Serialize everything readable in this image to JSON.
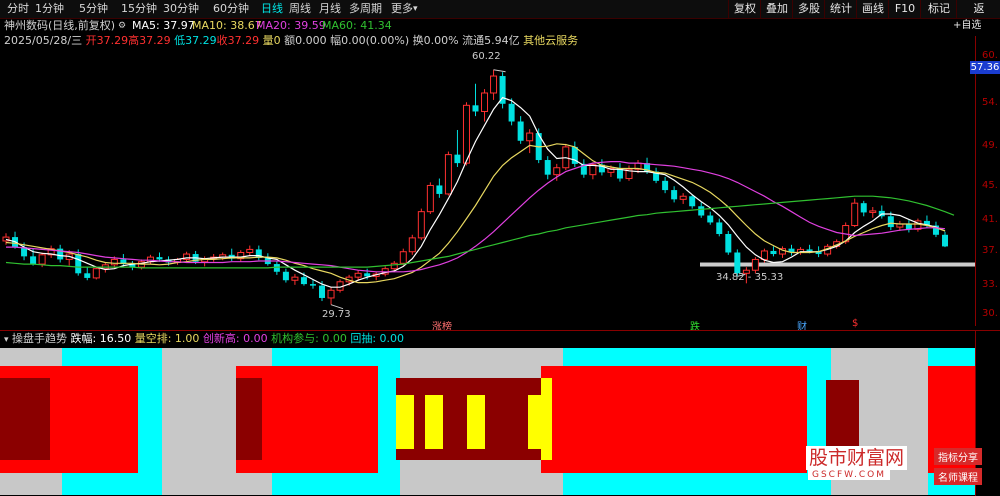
{
  "toolbar": {
    "periods": [
      "分时",
      "1分钟",
      "5分钟",
      "15分钟",
      "30分钟",
      "60分钟",
      "日线",
      "周线",
      "月线",
      "多周期",
      "更多"
    ],
    "active": "日线",
    "right": [
      "复权",
      "叠加",
      "多股",
      "统计",
      "画线",
      "F10",
      "标记",
      "返"
    ],
    "dropdown": "▾"
  },
  "header": {
    "name": "神州数码(日线,前复权)",
    "ma5": "MA5: 37.97",
    "ma10": "MA10: 38.67",
    "ma20": "MA20: 39.59",
    "ma60": "MA60: 41.34",
    "add": "+自选"
  },
  "quote": {
    "date": "2025/05/28/三",
    "open": "开37.29",
    "high": "高37.29",
    "low": "低37.29",
    "close": "收37.29",
    "vol": "量0",
    "amount": "额0.000",
    "amp": "幅0.00(0.00%)",
    "turn": "换0.00%",
    "float": "流通5.94亿",
    "cloud": "其他云服务"
  },
  "axis": {
    "ticks": [
      "60.",
      "57.36",
      "54.",
      "49.",
      "45.",
      "41.",
      "37.",
      "33.",
      "30."
    ],
    "current": "57.36"
  },
  "marks": {
    "high": "60.22",
    "low": "29.73",
    "range": "34.82 - 35.33"
  },
  "labels": {
    "l1": "涨榜",
    "l2": "跌",
    "l3": "财",
    "l4": "$"
  },
  "indicator": {
    "name": "操盘手趋势",
    "drop": "跌幅: 16.50",
    "vol": "量空排: 1.00",
    "newhigh": "创新高: 0.00",
    "inst": "机构参与: 0.00",
    "back": "回抽: 0.00"
  },
  "watermark": {
    "site": "股市财富网",
    "url": "GSCFW.COM",
    "tag1": "指标分享",
    "tag2": "名师课程"
  },
  "colors": {
    "up": "#ff3030",
    "down": "#00e0e0",
    "ma5": "#ffffff",
    "ma10": "#e8d860",
    "ma20": "#e040e0",
    "ma60": "#30c030"
  },
  "chart_data": {
    "type": "candlestick",
    "y_range": [
      28,
      62
    ],
    "candles": [
      [
        38,
        39,
        37.5,
        38.5
      ],
      [
        38.5,
        39.2,
        37,
        37.2
      ],
      [
        37.2,
        37.8,
        35.5,
        36
      ],
      [
        36,
        37,
        34.8,
        35
      ],
      [
        35,
        36.5,
        34.6,
        36.2
      ],
      [
        36.2,
        37.4,
        35.8,
        37
      ],
      [
        37,
        37.5,
        35.2,
        35.6
      ],
      [
        35.6,
        36.8,
        34.8,
        36.3
      ],
      [
        36.3,
        36.9,
        33.5,
        33.8
      ],
      [
        33.8,
        34.6,
        32.9,
        33.2
      ],
      [
        33.2,
        34.7,
        33,
        34.4
      ],
      [
        34.4,
        35.2,
        33.9,
        34.9
      ],
      [
        34.9,
        36,
        34.5,
        35.6
      ],
      [
        35.6,
        36.3,
        34.7,
        35
      ],
      [
        35,
        35.4,
        34.2,
        34.6
      ],
      [
        34.6,
        35.6,
        34.3,
        35.3
      ],
      [
        35.3,
        36.2,
        35,
        35.9
      ],
      [
        35.9,
        36.5,
        35.3,
        35.6
      ],
      [
        35.6,
        36,
        34.8,
        35.2
      ],
      [
        35.2,
        35.8,
        34.9,
        35.6
      ],
      [
        35.6,
        36.6,
        35.2,
        36.3
      ],
      [
        36.3,
        36.7,
        35,
        35.3
      ],
      [
        35.3,
        36,
        34.7,
        35.7
      ],
      [
        35.7,
        36.3,
        35.3,
        35.9
      ],
      [
        35.9,
        36.5,
        35.5,
        36.2
      ],
      [
        36.2,
        37,
        35.4,
        35.7
      ],
      [
        35.7,
        36.8,
        35.3,
        36.5
      ],
      [
        36.5,
        37.4,
        36,
        36.9
      ],
      [
        36.9,
        37.4,
        35.5,
        35.8
      ],
      [
        35.8,
        36.4,
        34.8,
        35
      ],
      [
        35,
        35.4,
        33.6,
        34
      ],
      [
        34,
        34.4,
        32.6,
        32.9
      ],
      [
        32.9,
        33.7,
        32.3,
        33.3
      ],
      [
        33.3,
        33.9,
        32.2,
        32.4
      ],
      [
        32.4,
        33,
        31.8,
        32.2
      ],
      [
        32.2,
        32.8,
        30.2,
        30.6
      ],
      [
        30.6,
        32,
        29.73,
        31.6
      ],
      [
        31.6,
        33,
        31.3,
        32.7
      ],
      [
        32.7,
        33.6,
        32.2,
        33.3
      ],
      [
        33.3,
        34.2,
        32.8,
        33.8
      ],
      [
        33.8,
        34.4,
        33,
        33.4
      ],
      [
        33.4,
        34,
        32.9,
        33.7
      ],
      [
        33.7,
        34.7,
        33.4,
        34.4
      ],
      [
        34.4,
        35.4,
        34,
        35.1
      ],
      [
        35.1,
        37,
        34.8,
        36.6
      ],
      [
        36.6,
        38.8,
        36.2,
        38.4
      ],
      [
        38.4,
        42.2,
        38.1,
        41.8
      ],
      [
        41.8,
        45.6,
        41.5,
        45.2
      ],
      [
        45.2,
        46.1,
        43.6,
        44.1
      ],
      [
        44.1,
        49.6,
        43.9,
        49.2
      ],
      [
        49.2,
        52.4,
        47.6,
        48.1
      ],
      [
        48.1,
        56,
        47.8,
        55.6
      ],
      [
        55.6,
        58.4,
        54.2,
        54.8
      ],
      [
        54.8,
        57.7,
        53.5,
        57.2
      ],
      [
        57.2,
        60.22,
        56.3,
        59.4
      ],
      [
        59.4,
        59.9,
        55.2,
        55.8
      ],
      [
        55.8,
        56.5,
        53,
        53.5
      ],
      [
        53.5,
        54.2,
        50.6,
        51
      ],
      [
        51,
        52.5,
        49.4,
        52
      ],
      [
        52,
        52.6,
        48.1,
        48.5
      ],
      [
        48.5,
        49,
        46,
        46.6
      ],
      [
        46.6,
        48,
        45.8,
        47.5
      ],
      [
        47.5,
        50.6,
        47.2,
        50.2
      ],
      [
        50.2,
        50.9,
        47.6,
        48
      ],
      [
        48,
        48.6,
        46.2,
        46.6
      ],
      [
        46.6,
        48.2,
        46,
        47.9
      ],
      [
        47.9,
        48.6,
        46.5,
        46.9
      ],
      [
        46.9,
        47.8,
        46.3,
        47.4
      ],
      [
        47.4,
        48.1,
        45.7,
        46.1
      ],
      [
        46.1,
        47.8,
        45.8,
        47.3
      ],
      [
        47.3,
        48.5,
        46.8,
        48.1
      ],
      [
        48.1,
        48.8,
        46.7,
        47
      ],
      [
        47,
        47.5,
        45.5,
        45.8
      ],
      [
        45.8,
        46.3,
        44.2,
        44.6
      ],
      [
        44.6,
        45.1,
        43,
        43.4
      ],
      [
        43.4,
        44.2,
        42.8,
        43.8
      ],
      [
        43.8,
        44,
        42.2,
        42.5
      ],
      [
        42.5,
        43,
        41,
        41.3
      ],
      [
        41.3,
        41.8,
        40.1,
        40.4
      ],
      [
        40.4,
        40.9,
        38.6,
        38.9
      ],
      [
        38.9,
        39.3,
        36.2,
        36.5
      ],
      [
        36.5,
        36.9,
        33.4,
        33.8
      ],
      [
        33.8,
        34.6,
        32.5,
        34.2
      ],
      [
        34.2,
        35.9,
        33.8,
        35.6
      ],
      [
        35.6,
        37,
        35.2,
        36.7
      ],
      [
        36.7,
        37.3,
        36,
        36.3
      ],
      [
        36.3,
        37.3,
        35.8,
        37
      ],
      [
        37,
        37.5,
        36.1,
        36.5
      ],
      [
        36.5,
        37.2,
        36.2,
        36.9
      ],
      [
        36.9,
        37.5,
        36.4,
        36.7
      ],
      [
        36.7,
        37.3,
        35.9,
        36.3
      ],
      [
        36.3,
        37.6,
        36,
        37.3
      ],
      [
        37.3,
        38.2,
        37,
        37.9
      ],
      [
        37.9,
        40.4,
        37.6,
        40
      ],
      [
        40,
        43.5,
        39.8,
        42.9
      ],
      [
        42.9,
        43.2,
        41.2,
        41.7
      ],
      [
        41.7,
        42.4,
        41,
        41.9
      ],
      [
        41.9,
        42.6,
        40.9,
        41.2
      ],
      [
        41.2,
        41.8,
        39.4,
        39.8
      ],
      [
        39.8,
        40.6,
        39.3,
        40.2
      ],
      [
        40.2,
        40.7,
        39.1,
        39.5
      ],
      [
        39.5,
        40.9,
        39.2,
        40.6
      ],
      [
        40.6,
        41.3,
        39.7,
        40
      ],
      [
        40,
        40.5,
        38.5,
        38.8
      ],
      [
        38.8,
        39.2,
        37.2,
        37.29
      ]
    ],
    "ma": {
      "ma5": [
        38.2,
        37.9,
        37.2,
        36.6,
        36.4,
        36.3,
        36.1,
        36,
        35.6,
        35.1,
        34.6,
        34.3,
        34.4,
        34.8,
        35,
        35.1,
        35.3,
        35.4,
        35.5,
        35.6,
        35.8,
        35.8,
        35.7,
        35.8,
        35.9,
        35.9,
        35.9,
        36.1,
        36.1,
        35.8,
        35.6,
        34.9,
        34.2,
        33.6,
        33,
        32.4,
        32,
        32,
        32.4,
        32.9,
        33.3,
        33.6,
        33.9,
        34.1,
        34.7,
        35.7,
        37.3,
        39.5,
        41.4,
        43.5,
        45.7,
        48.4,
        50.9,
        53,
        55.1,
        56.6,
        56.2,
        55.3,
        54.2,
        51.8,
        49.9,
        48.7,
        48.8,
        48.5,
        47.8,
        47.8,
        47.7,
        47.3,
        47.3,
        47.1,
        47,
        47,
        46.8,
        46.6,
        45.9,
        45,
        44,
        43.1,
        42.3,
        41.3,
        40.1,
        38.6,
        37.2,
        36.2,
        35.5,
        35.2,
        35.3,
        35.9,
        36.6,
        36.6,
        36.6,
        36.9,
        37.3,
        38,
        39.1,
        39.9,
        40.6,
        41.5,
        41.5,
        41.3,
        40.8,
        40.3,
        40.1,
        39.8,
        39.3
      ],
      "ma10": [
        37.8,
        37.7,
        37.5,
        37.3,
        37.1,
        36.9,
        36.7,
        36.5,
        36.2,
        35.9,
        35.5,
        35.2,
        35.1,
        35.1,
        35.1,
        35,
        35,
        34.9,
        35,
        35.2,
        35.3,
        35.5,
        35.6,
        35.6,
        35.7,
        35.8,
        35.8,
        35.8,
        35.9,
        35.9,
        35.8,
        35.5,
        35.1,
        34.8,
        34.4,
        34.1,
        33.8,
        33.3,
        32.9,
        32.6,
        32.6,
        32.7,
        32.9,
        33.1,
        33.5,
        33.9,
        34.6,
        35.5,
        36.4,
        37.7,
        39.2,
        40.9,
        42.6,
        44.5,
        46.4,
        47.8,
        48.8,
        49.6,
        50.4,
        50.2,
        50.3,
        50.6,
        50.5,
        50.2,
        49.3,
        48.4,
        47.8,
        47.6,
        47.4,
        47.4,
        47.4,
        47.2,
        46.9,
        46.8,
        46.4,
        46,
        45.6,
        45,
        44.3,
        43.4,
        42.4,
        41.2,
        40,
        38.9,
        38,
        37.4,
        36.8,
        36.5,
        36.5,
        36.5,
        36.6,
        37,
        37.5,
        38,
        38.6,
        39.1,
        39.6,
        40,
        40.3,
        40.2,
        40.2,
        40.2,
        40,
        39.7,
        39.3
      ],
      "ma20": [
        37.2,
        37.2,
        37.1,
        37,
        36.9,
        36.8,
        36.7,
        36.6,
        36.5,
        36.3,
        36.1,
        35.9,
        35.8,
        35.7,
        35.6,
        35.5,
        35.5,
        35.4,
        35.3,
        35.3,
        35.2,
        35.2,
        35.2,
        35.2,
        35.2,
        35.3,
        35.3,
        35.3,
        35.4,
        35.4,
        35.4,
        35.3,
        35.2,
        35.1,
        35,
        34.9,
        34.8,
        34.6,
        34.4,
        34.2,
        34.1,
        34,
        34,
        34,
        34,
        34.1,
        34.3,
        34.6,
        34.9,
        35.3,
        35.8,
        36.5,
        37.3,
        38.2,
        39.2,
        40.3,
        41.4,
        42.5,
        43.6,
        44.6,
        45.5,
        46.3,
        47,
        47.4,
        47.8,
        48.1,
        48.2,
        48.3,
        48.3,
        48.1,
        48.1,
        48,
        47.9,
        47.8,
        47.7,
        47.5,
        47.3,
        47.1,
        46.8,
        46.5,
        46.1,
        45.6,
        45,
        44.4,
        43.8,
        43.1,
        42.5,
        41.8,
        41.1,
        40.4,
        39.9,
        39.5,
        39.1,
        38.9,
        38.7,
        38.8,
        38.9,
        39,
        39.2,
        39.4,
        39.5,
        39.6,
        39.7,
        39.7,
        39.59
      ],
      "ma60": [
        35.2,
        35.1,
        35,
        35,
        34.9,
        34.8,
        34.8,
        34.7,
        34.6,
        34.6,
        34.6,
        34.6,
        34.6,
        34.6,
        34.6,
        34.5,
        34.5,
        34.5,
        34.5,
        34.5,
        34.5,
        34.5,
        34.5,
        34.5,
        34.5,
        34.5,
        34.5,
        34.5,
        34.5,
        34.5,
        34.6,
        34.6,
        34.6,
        34.6,
        34.6,
        34.6,
        34.6,
        34.6,
        34.6,
        34.6,
        34.6,
        34.7,
        34.8,
        34.9,
        35,
        35.2,
        35.4,
        35.6,
        35.8,
        36,
        36.3,
        36.6,
        36.9,
        37.2,
        37.5,
        37.8,
        38.1,
        38.4,
        38.7,
        38.9,
        39.2,
        39.4,
        39.7,
        39.9,
        40.1,
        40.3,
        40.5,
        40.7,
        40.9,
        41.1,
        41.3,
        41.4,
        41.6,
        41.7,
        41.8,
        41.9,
        42,
        42.1,
        42.2,
        42.3,
        42.4,
        42.5,
        42.6,
        42.7,
        42.8,
        42.9,
        43,
        43.1,
        43.2,
        43.3,
        43.4,
        43.5,
        43.6,
        43.7,
        43.8,
        43.8,
        43.8,
        43.7,
        43.6,
        43.4,
        43.2,
        42.9,
        42.6,
        42.2,
        41.8,
        41.34
      ]
    }
  }
}
